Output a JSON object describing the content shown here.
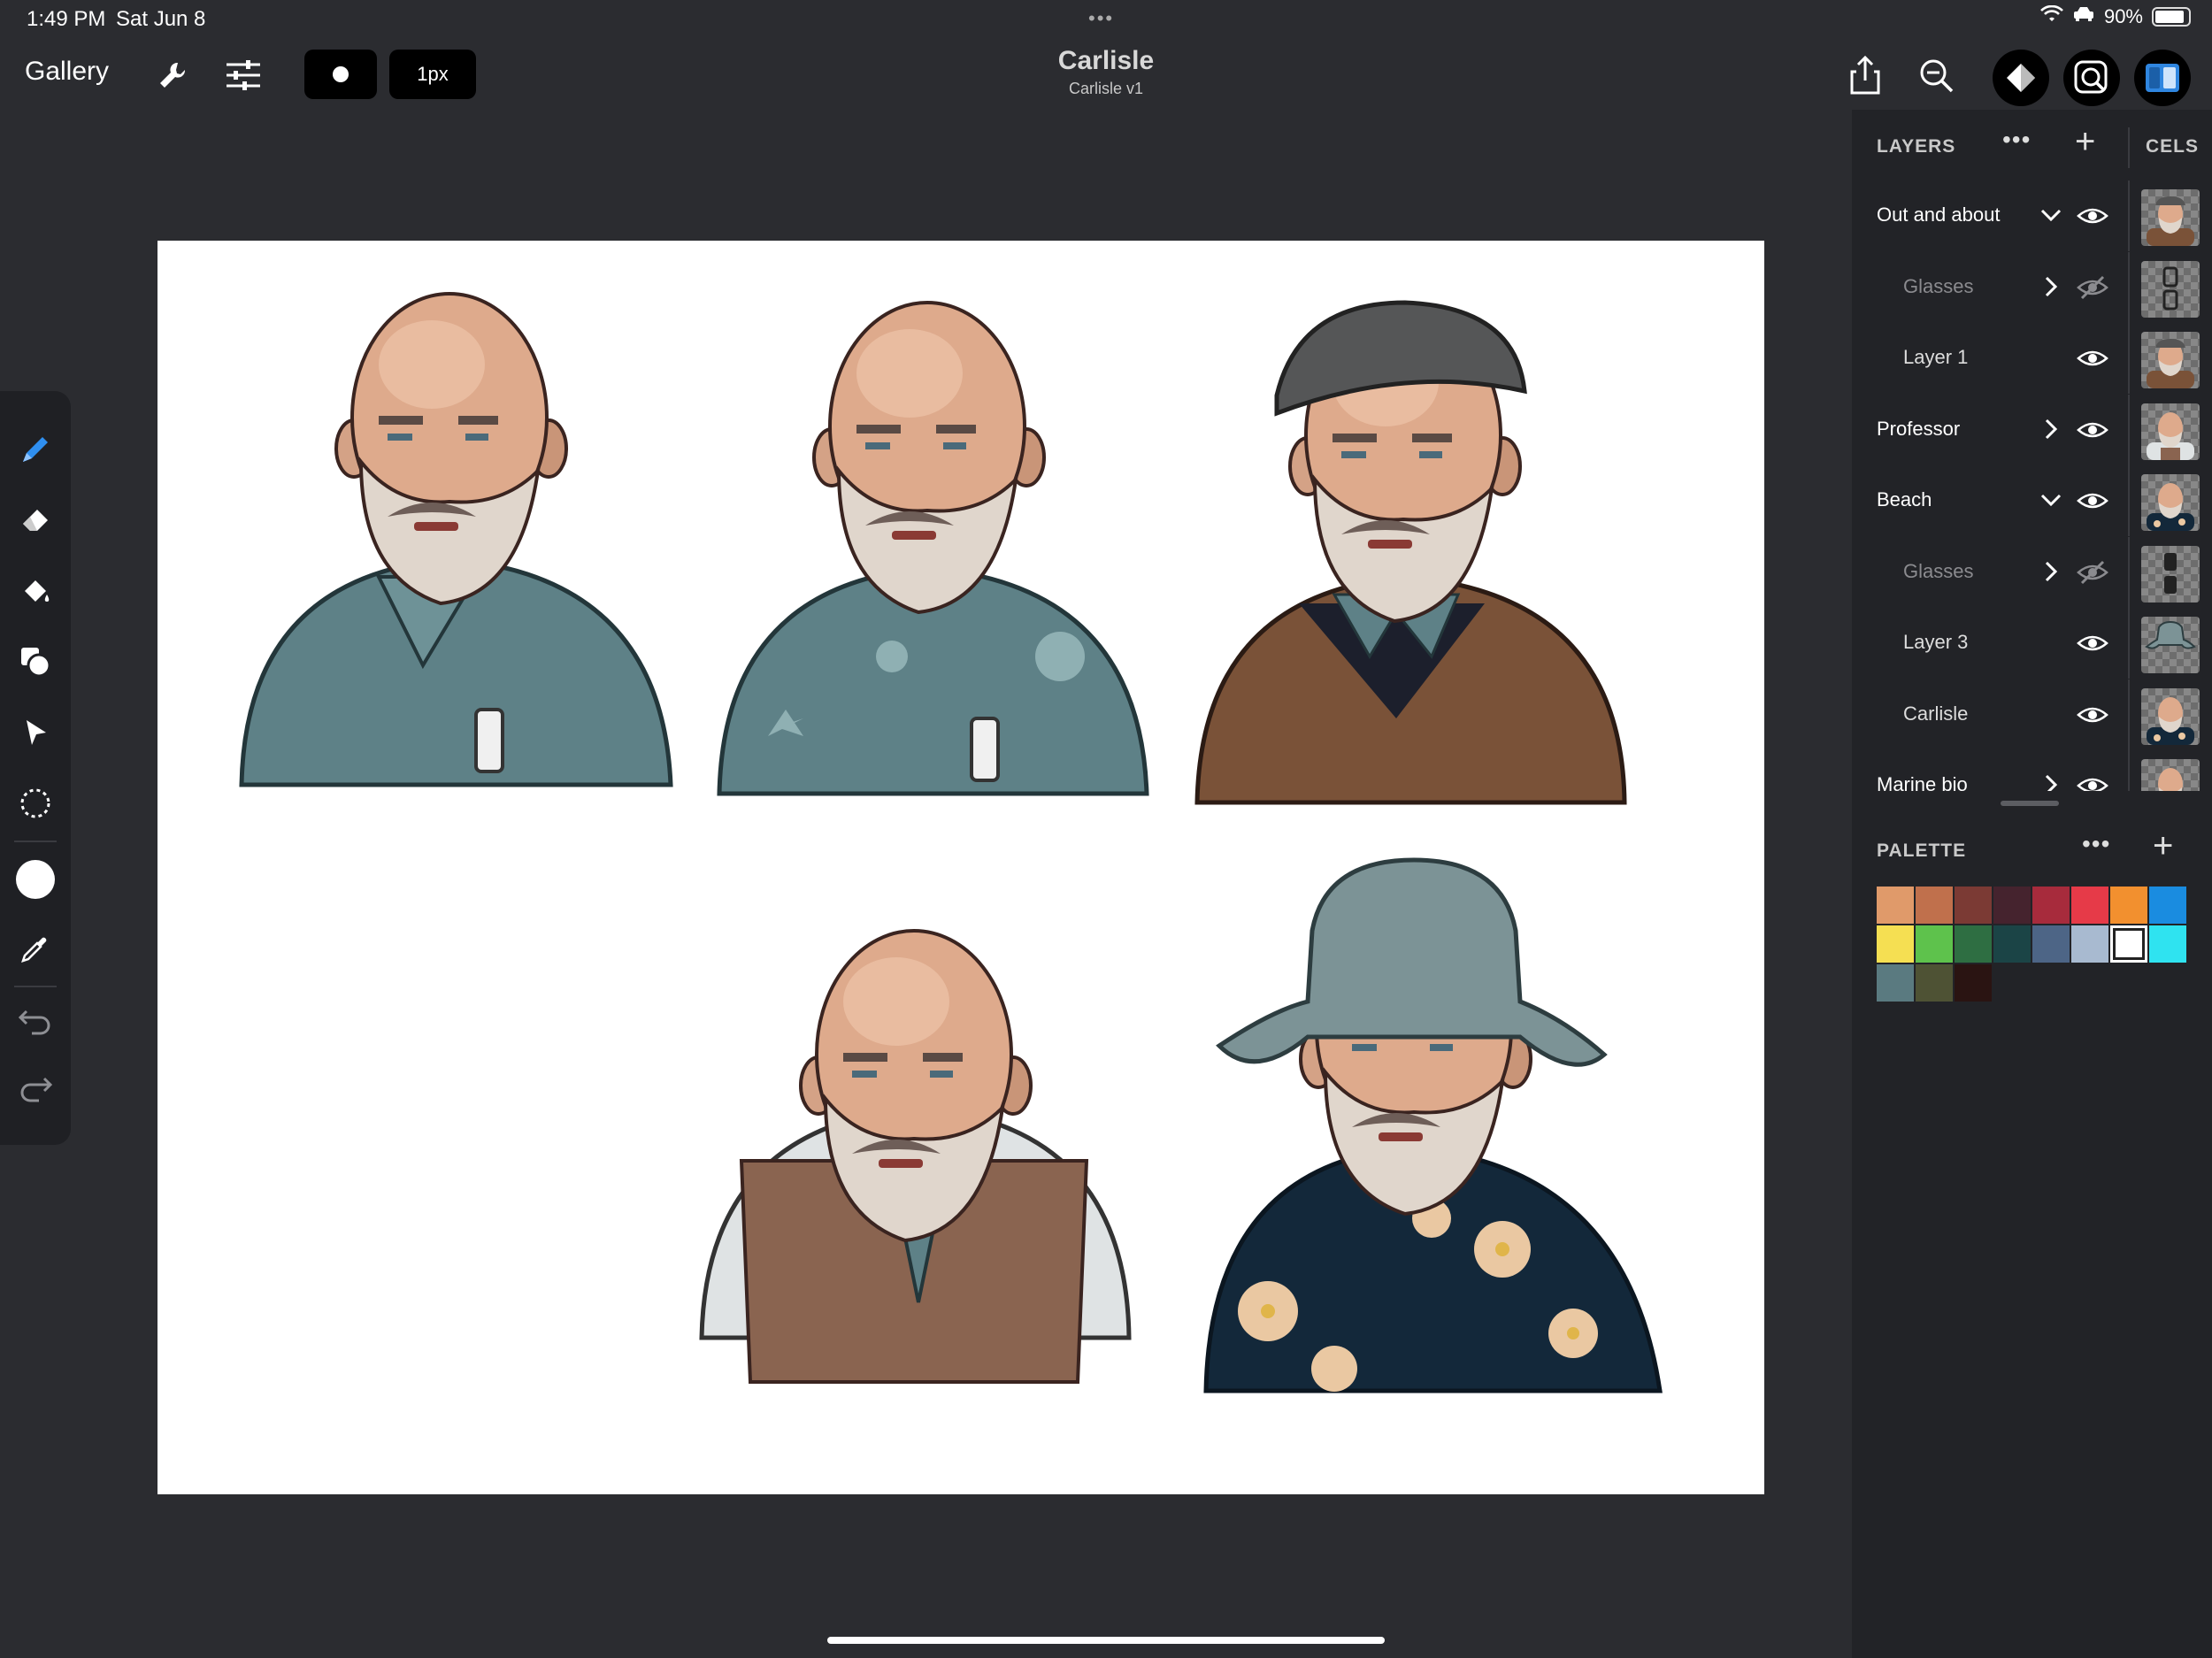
{
  "status": {
    "time": "1:49 PM",
    "date": "Sat Jun 8",
    "battery": "90%",
    "battery_level": 0.9
  },
  "toolbar": {
    "gallery_label": "Gallery",
    "brush_size_label": "1px",
    "title": "Carlisle",
    "subtitle": "Carlisle v1"
  },
  "panel": {
    "layers_title": "LAYERS",
    "cels_title": "CELS",
    "layers": [
      {
        "name": "Out and about",
        "indent": false,
        "hidden": false,
        "expanded": true,
        "thumb": "hatman"
      },
      {
        "name": "Glasses",
        "indent": true,
        "hidden": true,
        "expanded": false,
        "thumb": "glasses"
      },
      {
        "name": "Layer 1",
        "indent": true,
        "hidden": false,
        "expanded": null,
        "thumb": "hatman"
      },
      {
        "name": "Professor",
        "indent": false,
        "hidden": false,
        "expanded": false,
        "thumb": "professor"
      },
      {
        "name": "Beach",
        "indent": false,
        "hidden": false,
        "expanded": true,
        "thumb": "beach"
      },
      {
        "name": "Glasses",
        "indent": true,
        "hidden": true,
        "expanded": false,
        "thumb": "sunglasses"
      },
      {
        "name": "Layer 3",
        "indent": true,
        "hidden": false,
        "expanded": null,
        "thumb": "hat"
      },
      {
        "name": "Carlisle",
        "indent": true,
        "hidden": false,
        "expanded": null,
        "thumb": "beach"
      },
      {
        "name": "Marine bio",
        "indent": false,
        "hidden": false,
        "expanded": false,
        "thumb": "bald"
      }
    ],
    "palette_title": "PALETTE",
    "palette": [
      "#e09a6a",
      "#c0704c",
      "#7b3a34",
      "#45232e",
      "#a72b3c",
      "#e63a48",
      "#f2902f",
      "#1a8ce0",
      "#f5df52",
      "#5ec24c",
      "#2e6e42",
      "#1b4446",
      "#4d6586",
      "#a8bad0",
      "#ffffff",
      "#2fe3f0",
      "#5a7a80",
      "#4e5234",
      "#2a1412"
    ],
    "palette_selected": 14
  },
  "icons": {
    "settings": "wrench-icon",
    "adjustments": "sliders-icon",
    "share": "share-icon",
    "zoom": "zoom-icon",
    "tools": [
      "pencil-icon",
      "eraser-icon",
      "fill-bucket-icon",
      "shapes-icon",
      "move-icon",
      "selection-icon",
      "color-icon",
      "eyedropper-icon",
      "undo-icon",
      "redo-icon"
    ]
  }
}
